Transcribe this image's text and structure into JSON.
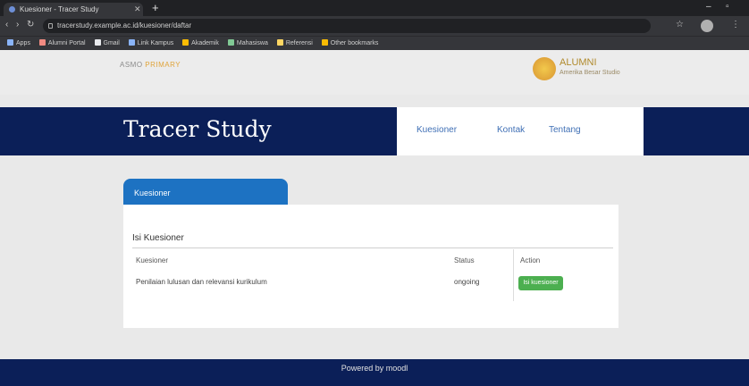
{
  "browser": {
    "tab_title": "Kuesioner - Tracer Study",
    "address": "tracerstudy.example.ac.id/kuesioner/daftar",
    "bookmarks": [
      "Apps",
      "Alumni Portal",
      "Gmail",
      "Link Kampus",
      "Akademik",
      "Mahasiswa",
      "Referensi",
      "Other bookmarks"
    ],
    "colors": {
      "chrome_dark": "#202124",
      "chrome": "#35363a"
    }
  },
  "site": {
    "small_brand_left": "ASMO",
    "small_brand_right": "PRIMARY",
    "alumni_title": "ALUMNI",
    "alumni_subtitle": "Amerika Besar Studio",
    "title": "Tracer Study",
    "menu": [
      "Kuesioner",
      "Kontak",
      "Tentang"
    ]
  },
  "panel": {
    "tab_label": "Kuesioner",
    "section_title": "Isi Kuesioner",
    "columns": [
      "Kuesioner",
      "Status",
      "Action"
    ],
    "rows": [
      {
        "name": "Penilaian lulusan dan relevansi kurikulum",
        "status": "ongoing",
        "action": "Isi kuesioner"
      }
    ]
  },
  "footer": {
    "text": "Powered by moodl"
  },
  "colors": {
    "navy": "#0b1f58",
    "accent_blue": "#1d72c2",
    "green": "#4caf50"
  }
}
